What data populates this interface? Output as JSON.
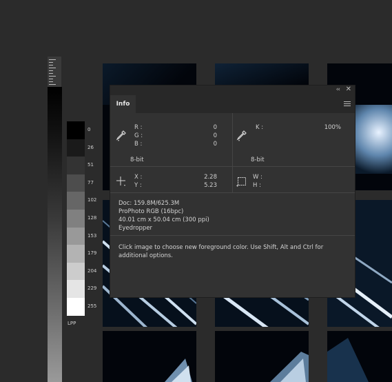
{
  "luminance_scale": {
    "values": [
      "0",
      "26",
      "51",
      "77",
      "102",
      "128",
      "153",
      "179",
      "204",
      "229",
      "255"
    ],
    "footer_label": "LPP"
  },
  "panel": {
    "tab_label": "Info",
    "collapse_glyph": "‹‹",
    "close_glyph": "✕",
    "rgb": {
      "r_label": "R :",
      "g_label": "G :",
      "b_label": "B :",
      "r_value": "0",
      "g_value": "0",
      "b_value": "0",
      "bit_depth": "8-bit"
    },
    "k": {
      "label": "K :",
      "value": "100%",
      "bit_depth": "8-bit"
    },
    "xy": {
      "x_label": "X :",
      "y_label": "Y :",
      "x_value": "2.28",
      "y_value": "5.23"
    },
    "wh": {
      "w_label": "W :",
      "h_label": "H :"
    },
    "doc_info": {
      "doc": "Doc: 159.8M/625.3M",
      "profile": "ProPhoto RGB (16bpc)",
      "dimensions": "40.01 cm x 50.04 cm (300 ppi)",
      "tool": "Eyedropper"
    },
    "hint": "Click image to choose new foreground color.  Use Shift, Alt and Ctrl for additional options."
  }
}
